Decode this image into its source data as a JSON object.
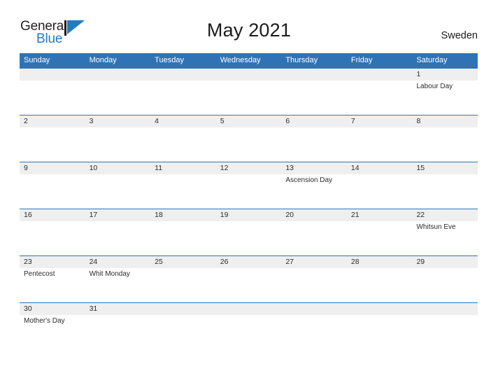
{
  "logo": {
    "word_one": "General",
    "word_two": "Blue",
    "flag_icon": "blue-triangle-flag-icon",
    "blue": "#1f7cc2"
  },
  "header": {
    "title": "May 2021",
    "country": "Sweden"
  },
  "theme": {
    "header_blue": "#3073b5",
    "row_rule_blue": "#2e75b6",
    "band_gray": "#efefef",
    "text": "#2b2b2b",
    "page_bg": "#ffffff"
  },
  "calendar": {
    "weekdays": [
      "Sunday",
      "Monday",
      "Tuesday",
      "Wednesday",
      "Thursday",
      "Friday",
      "Saturday"
    ],
    "weeks": [
      [
        {
          "num": "",
          "event": ""
        },
        {
          "num": "",
          "event": ""
        },
        {
          "num": "",
          "event": ""
        },
        {
          "num": "",
          "event": ""
        },
        {
          "num": "",
          "event": ""
        },
        {
          "num": "",
          "event": ""
        },
        {
          "num": "1",
          "event": "Labour Day"
        }
      ],
      [
        {
          "num": "2",
          "event": ""
        },
        {
          "num": "3",
          "event": ""
        },
        {
          "num": "4",
          "event": ""
        },
        {
          "num": "5",
          "event": ""
        },
        {
          "num": "6",
          "event": ""
        },
        {
          "num": "7",
          "event": ""
        },
        {
          "num": "8",
          "event": ""
        }
      ],
      [
        {
          "num": "9",
          "event": ""
        },
        {
          "num": "10",
          "event": ""
        },
        {
          "num": "11",
          "event": ""
        },
        {
          "num": "12",
          "event": ""
        },
        {
          "num": "13",
          "event": "Ascension Day"
        },
        {
          "num": "14",
          "event": ""
        },
        {
          "num": "15",
          "event": ""
        }
      ],
      [
        {
          "num": "16",
          "event": ""
        },
        {
          "num": "17",
          "event": ""
        },
        {
          "num": "18",
          "event": ""
        },
        {
          "num": "19",
          "event": ""
        },
        {
          "num": "20",
          "event": ""
        },
        {
          "num": "21",
          "event": ""
        },
        {
          "num": "22",
          "event": "Whitsun Eve"
        }
      ],
      [
        {
          "num": "23",
          "event": "Pentecost"
        },
        {
          "num": "24",
          "event": "Whit Monday"
        },
        {
          "num": "25",
          "event": ""
        },
        {
          "num": "26",
          "event": ""
        },
        {
          "num": "27",
          "event": ""
        },
        {
          "num": "28",
          "event": ""
        },
        {
          "num": "29",
          "event": ""
        }
      ],
      [
        {
          "num": "30",
          "event": "Mother's Day"
        },
        {
          "num": "31",
          "event": ""
        },
        {
          "num": "",
          "event": ""
        },
        {
          "num": "",
          "event": ""
        },
        {
          "num": "",
          "event": ""
        },
        {
          "num": "",
          "event": ""
        },
        {
          "num": "",
          "event": ""
        }
      ]
    ]
  }
}
